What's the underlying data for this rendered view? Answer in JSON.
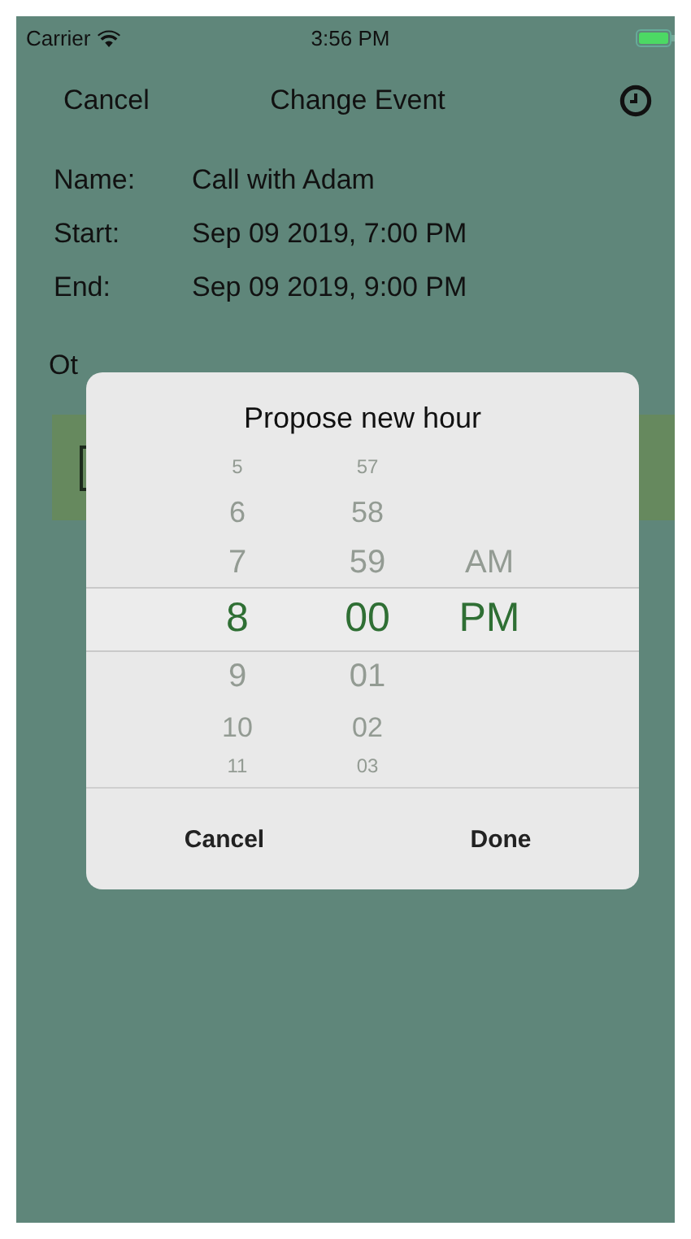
{
  "status_bar": {
    "carrier": "Carrier",
    "time": "3:56 PM"
  },
  "nav": {
    "left_button": "Cancel",
    "title": "Change Event"
  },
  "fields": [
    {
      "label": "Name:",
      "value": "Call with Adam"
    },
    {
      "label": "Start:",
      "value": "Sep 09 2019, 7:00 PM"
    },
    {
      "label": "End:",
      "value": "Sep 09 2019, 9:00 PM"
    }
  ],
  "section_label": "Ot",
  "dialog": {
    "title": "Propose new hour",
    "columns": [
      [
        {
          "label": "5",
          "selected": false
        },
        {
          "label": "6",
          "selected": false
        },
        {
          "label": "7",
          "selected": false
        },
        {
          "label": "8",
          "selected": true
        },
        {
          "label": "9",
          "selected": false
        },
        {
          "label": "10",
          "selected": false
        },
        {
          "label": "11",
          "selected": false
        }
      ],
      [
        {
          "label": "57",
          "selected": false
        },
        {
          "label": "58",
          "selected": false
        },
        {
          "label": "59",
          "selected": false
        },
        {
          "label": "00",
          "selected": true
        },
        {
          "label": "01",
          "selected": false
        },
        {
          "label": "02",
          "selected": false
        },
        {
          "label": "03",
          "selected": false
        }
      ],
      [
        {
          "label": "AM",
          "selected": false
        },
        {
          "label": "PM",
          "selected": true
        }
      ]
    ],
    "buttons": [
      "Cancel",
      "Done"
    ]
  }
}
